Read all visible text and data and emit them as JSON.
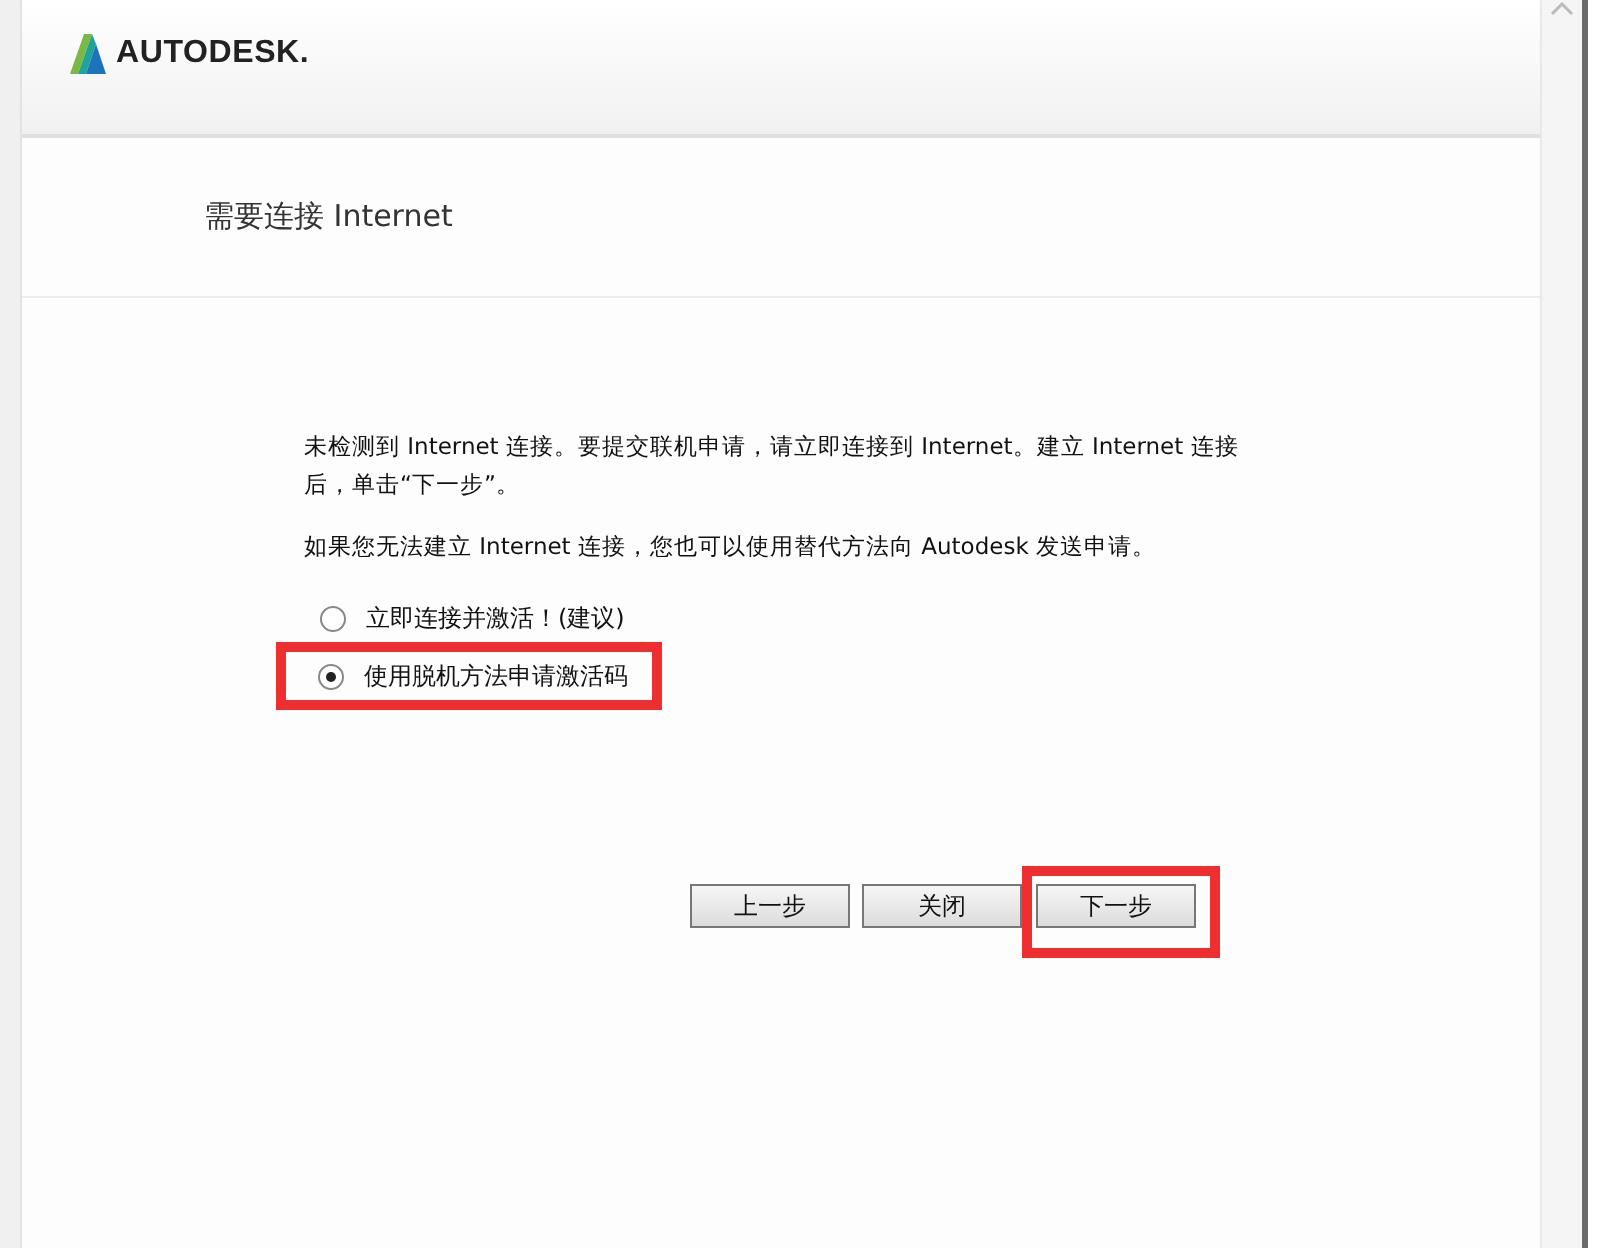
{
  "header": {
    "logo_text": "AUTODESK."
  },
  "title": "需要连接 Internet",
  "paragraphs": [
    "未检测到 Internet 连接。要提交联机申请，请立即连接到 Internet。建立 Internet 连接后，单击“下一步”。",
    "如果您无法建立 Internet 连接，您也可以使用替代方法向 Autodesk 发送申请。"
  ],
  "options": [
    {
      "label": "立即连接并激活！(建议)",
      "selected": false,
      "highlighted": false
    },
    {
      "label": "使用脱机方法申请激活码",
      "selected": true,
      "highlighted": true
    }
  ],
  "buttons": [
    {
      "label": "上一步",
      "highlighted": false
    },
    {
      "label": "关闭",
      "highlighted": false
    },
    {
      "label": "下一步",
      "highlighted": true
    }
  ]
}
